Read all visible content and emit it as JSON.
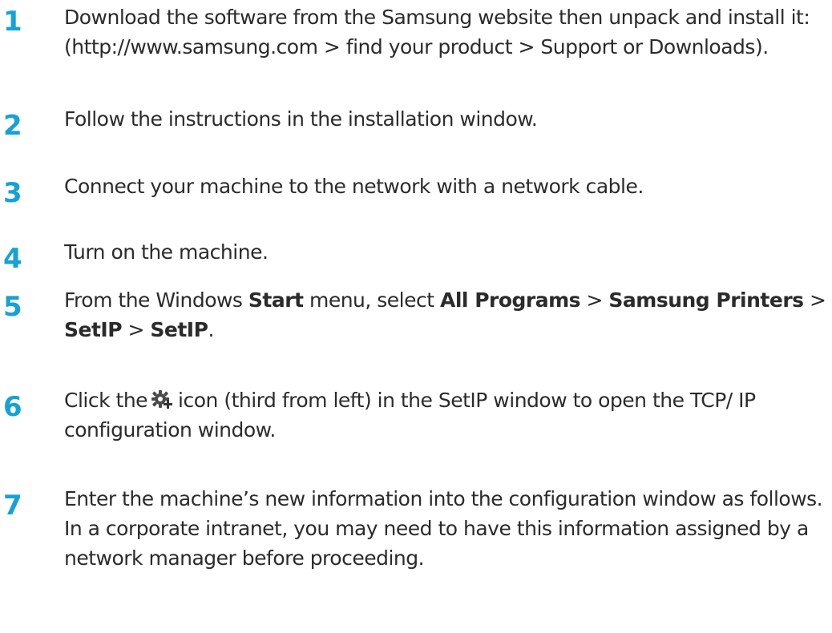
{
  "steps": [
    {
      "number": "1",
      "text": " Download the software from the Samsung website then unpack and install it: (http://www.samsung.com > find your product > Support or Downloads)."
    },
    {
      "number": "2",
      "text": "Follow the instructions in the installation window."
    },
    {
      "number": "3",
      "text": "Connect your machine to the network with a network cable."
    },
    {
      "number": "4",
      "text": "Turn on the machine."
    },
    {
      "number": "5",
      "parts": {
        "p1": "From the Windows ",
        "b1": "Start",
        "p2": " menu, select ",
        "b2": "All Programs",
        "p3": " > ",
        "b3": "Samsung Printers",
        "p4": " > ",
        "b4": "SetIP",
        "p5": " > ",
        "b5": "SetIP",
        "p6": "."
      }
    },
    {
      "number": "6",
      "before_icon": "Click the",
      "icon": "gear-plus-icon",
      "after_icon": "icon (third from left) in the SetIP window to open the TCP/ IP configuration window."
    },
    {
      "number": "7",
      "text": "Enter the machine’s new information into the configuration window as follows. In a corporate intranet, you may need to have this information assigned by a network manager before proceeding."
    }
  ],
  "colors": {
    "step_number": "#15a2d6",
    "body_text": "#2b2b2b",
    "icon_gear": "#4a4a4a",
    "icon_plus": "#333333"
  }
}
